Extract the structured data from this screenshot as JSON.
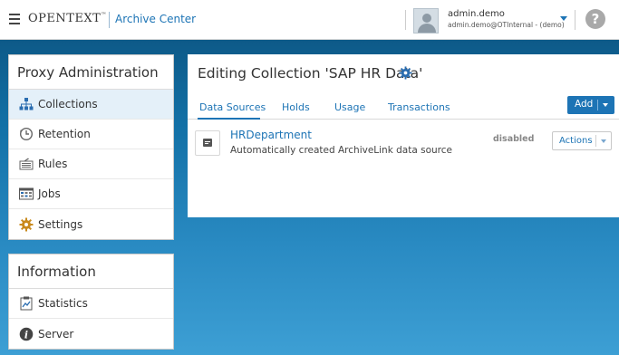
{
  "header": {
    "brand": "OPENTEXT",
    "brand_tm": "™",
    "app_name": "Archive Center",
    "user_name": "admin.demo",
    "user_email": "admin.demo@OTInternal - (demo)",
    "help_glyph": "?"
  },
  "sidebar": {
    "admin_title": "Proxy Administration",
    "admin_items": [
      {
        "label": "Collections",
        "icon": "collections-icon",
        "active": true
      },
      {
        "label": "Retention",
        "icon": "retention-icon"
      },
      {
        "label": "Rules",
        "icon": "rules-icon"
      },
      {
        "label": "Jobs",
        "icon": "jobs-icon"
      },
      {
        "label": "Settings",
        "icon": "settings-icon"
      }
    ],
    "info_title": "Information",
    "info_items": [
      {
        "label": "Statistics",
        "icon": "statistics-icon"
      },
      {
        "label": "Server",
        "icon": "info-icon"
      }
    ]
  },
  "main": {
    "title": "Editing Collection 'SAP HR Data'",
    "tabs": [
      "Data Sources",
      "Holds",
      "Usage",
      "Transactions"
    ],
    "active_tab": "Data Sources",
    "add_label": "Add",
    "data_sources": [
      {
        "name": "HRDepartment",
        "description": "Automatically created ArchiveLink data source",
        "status": "disabled",
        "actions_label": "Actions"
      }
    ]
  },
  "colors": {
    "accent": "#1d74b5",
    "background_top": "#0b4f7a",
    "background_bottom": "#3d9fd4"
  }
}
